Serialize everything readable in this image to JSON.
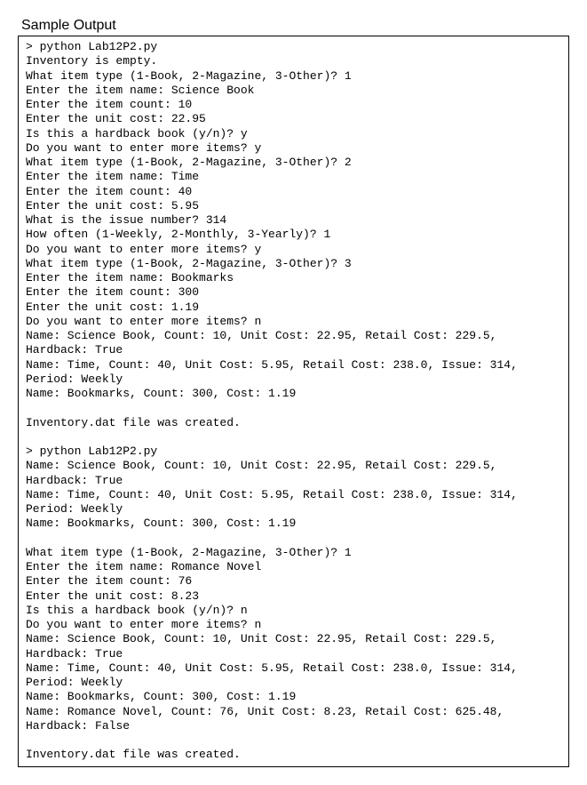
{
  "title": "Sample Output",
  "terminal_output": "> python Lab12P2.py\nInventory is empty.\nWhat item type (1-Book, 2-Magazine, 3-Other)? 1\nEnter the item name: Science Book\nEnter the item count: 10\nEnter the unit cost: 22.95\nIs this a hardback book (y/n)? y\nDo you want to enter more items? y\nWhat item type (1-Book, 2-Magazine, 3-Other)? 2\nEnter the item name: Time\nEnter the item count: 40\nEnter the unit cost: 5.95\nWhat is the issue number? 314\nHow often (1-Weekly, 2-Monthly, 3-Yearly)? 1\nDo you want to enter more items? y\nWhat item type (1-Book, 2-Magazine, 3-Other)? 3\nEnter the item name: Bookmarks\nEnter the item count: 300\nEnter the unit cost: 1.19\nDo you want to enter more items? n\nName: Science Book, Count: 10, Unit Cost: 22.95, Retail Cost: 229.5, Hardback: True\nName: Time, Count: 40, Unit Cost: 5.95, Retail Cost: 238.0, Issue: 314, Period: Weekly\nName: Bookmarks, Count: 300, Cost: 1.19\n\nInventory.dat file was created.\n\n> python Lab12P2.py\nName: Science Book, Count: 10, Unit Cost: 22.95, Retail Cost: 229.5, Hardback: True\nName: Time, Count: 40, Unit Cost: 5.95, Retail Cost: 238.0, Issue: 314, Period: Weekly\nName: Bookmarks, Count: 300, Cost: 1.19\n\nWhat item type (1-Book, 2-Magazine, 3-Other)? 1\nEnter the item name: Romance Novel\nEnter the item count: 76\nEnter the unit cost: 8.23\nIs this a hardback book (y/n)? n\nDo you want to enter more items? n\nName: Science Book, Count: 10, Unit Cost: 22.95, Retail Cost: 229.5, Hardback: True\nName: Time, Count: 40, Unit Cost: 5.95, Retail Cost: 238.0, Issue: 314, Period: Weekly\nName: Bookmarks, Count: 300, Cost: 1.19\nName: Romance Novel, Count: 76, Unit Cost: 8.23, Retail Cost: 625.48, Hardback: False\n\nInventory.dat file was created."
}
